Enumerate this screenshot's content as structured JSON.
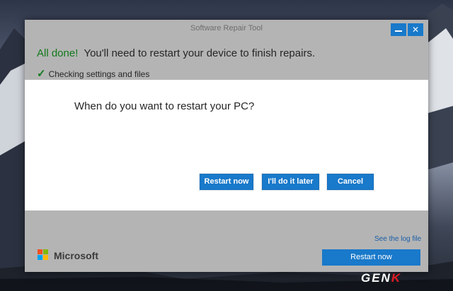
{
  "window": {
    "title": "Software Repair Tool",
    "minimize_glyph": "",
    "close_glyph": "✕"
  },
  "status": {
    "done_label": "All done!",
    "message": "You'll need to restart your device to finish repairs."
  },
  "check": {
    "icon": "✓",
    "label": "Checking settings and files"
  },
  "prompt": {
    "question": "When do you want to restart your PC?",
    "buttons": {
      "restart_now": "Restart now",
      "later": "I'll do it later",
      "cancel": "Cancel"
    }
  },
  "footer": {
    "log_link": "See the log file",
    "brand": "Microsoft",
    "primary_button": "Restart now"
  },
  "watermark": {
    "prefix": "GEN",
    "suffix": "K"
  },
  "colors": {
    "accent": "#1979ca",
    "success": "#127a1c",
    "window_bg": "#b4b4b4",
    "panel_bg": "#ffffff"
  }
}
